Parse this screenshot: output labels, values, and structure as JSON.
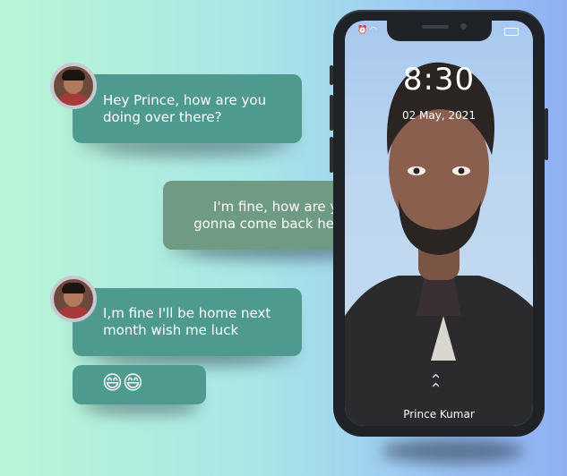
{
  "messages": [
    {
      "text": "Hey Prince, how are you doing over there?"
    },
    {
      "text": "I'm fine, how are you gonna come back here?"
    },
    {
      "text": "I,m fine I'll be home next month wish me luck"
    },
    {
      "text": "😄😄"
    }
  ],
  "phone": {
    "time": "8:30",
    "date": "02 May, 2021",
    "owner_name": "Prince Kumar"
  },
  "colors": {
    "bubble": "#4f9a8f",
    "bubble_reply": "#6f9a83",
    "phone_frame": "#1f2226"
  }
}
